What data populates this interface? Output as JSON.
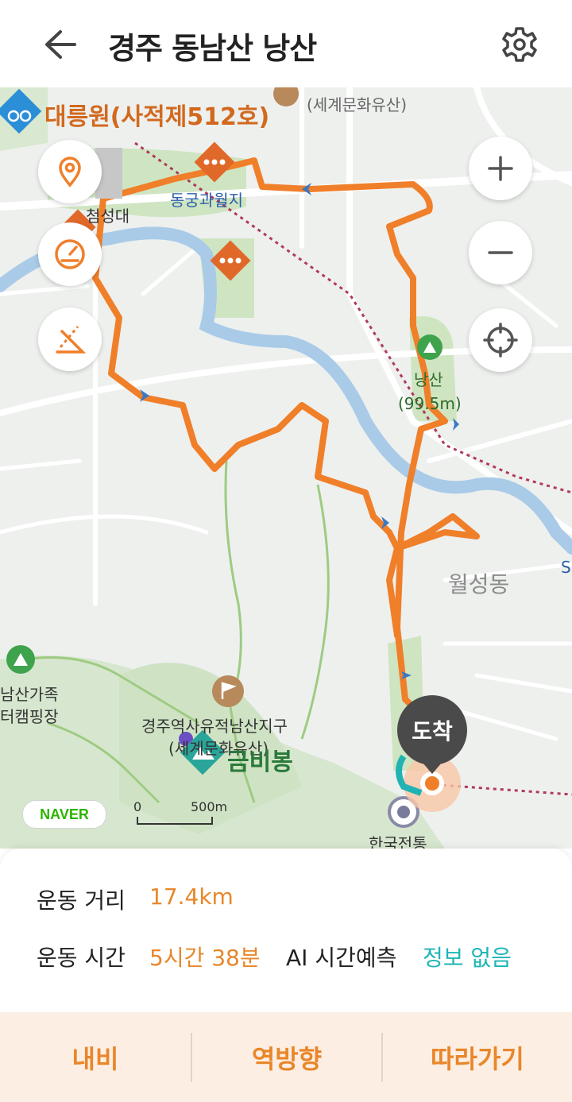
{
  "header": {
    "title": "경주 동남산  낭산"
  },
  "map": {
    "labels": {
      "daereungwon": "대릉원(사적제512호)",
      "world_heritage": "(세계문화유산)",
      "donggung": "동궁과월지",
      "cheomseongdae": "첨성대",
      "nangsan_name": "낭산",
      "nangsan_height": "(99.5m)",
      "wolseong": "월성동",
      "campsite_line1": "남산가족",
      "campsite_line2": "터캠핑장",
      "historic_line1": "경주역사유적남산지구",
      "historic_line2": "(세계문화유산)",
      "peak": "금비봉",
      "kepco": "한국전통",
      "edge_letter": "S"
    },
    "naver_logo": "NAVER",
    "scale": {
      "zero": "0",
      "max": "500m"
    },
    "arrive_label": "도착",
    "colors": {
      "route": "#f07f2a",
      "river": "#a9cbe8",
      "park": "#cde3c0"
    }
  },
  "stats": {
    "distance_label": "운동 거리",
    "distance_value": "17.4km",
    "time_label": "운동 시간",
    "time_value": "5시간 38분",
    "ai_label": "AI 시간예측",
    "ai_value": "정보 없음"
  },
  "bottom_bar": {
    "nav_label": "내비",
    "reverse_label": "역방향",
    "follow_label": "따라가기"
  }
}
